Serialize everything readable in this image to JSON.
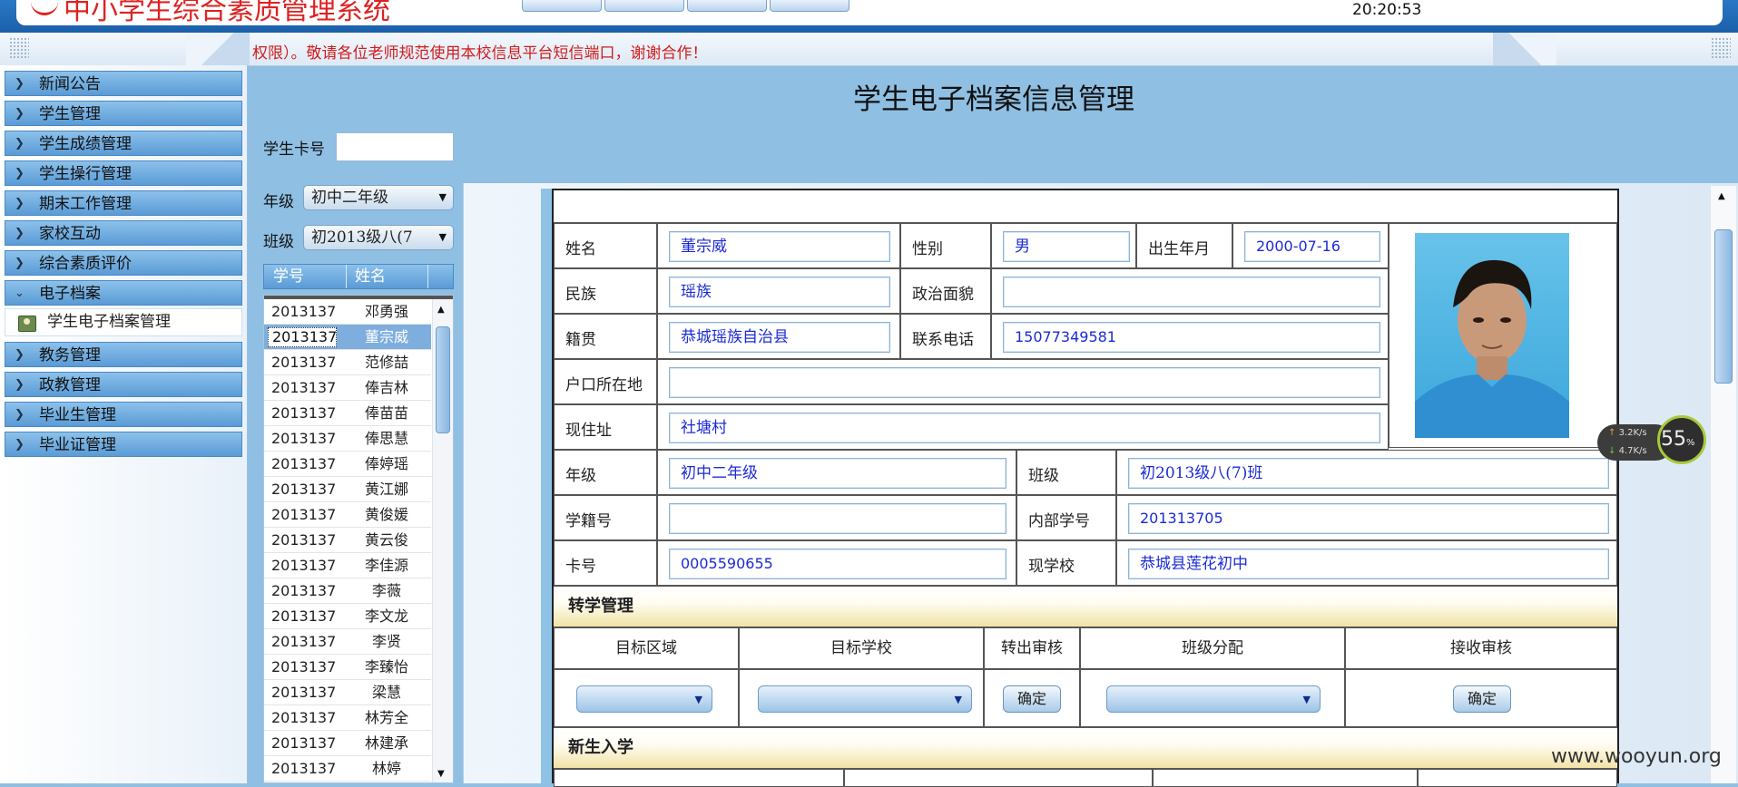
{
  "header": {
    "system_title": "中小学生综合素质管理系统",
    "clock": "20:20:53"
  },
  "marquee": "权限）。敬请各位老师规范使用本校信息平台短信端口，谢谢合作！",
  "sidebar": {
    "items": [
      {
        "label": "新闻公告"
      },
      {
        "label": "学生管理"
      },
      {
        "label": "学生成绩管理"
      },
      {
        "label": "学生操行管理"
      },
      {
        "label": "期末工作管理"
      },
      {
        "label": "家校互动"
      },
      {
        "label": "综合素质评价"
      },
      {
        "label": "电子档案"
      },
      {
        "label": "教务管理"
      },
      {
        "label": "政教管理"
      },
      {
        "label": "毕业生管理"
      },
      {
        "label": "毕业证管理"
      }
    ],
    "sub_item": "学生电子档案管理"
  },
  "main": {
    "title": "学生电子档案信息管理",
    "card_label": "学生卡号",
    "card_value": "",
    "grade_label": "年级",
    "grade_value": "初中二年级",
    "class_label": "班级",
    "class_value": "初2013级八(7",
    "list_headers": [
      "学号",
      "姓名"
    ],
    "students": [
      {
        "id": "2013137",
        "name": "邓勇强"
      },
      {
        "id": "2013137",
        "name": "董宗威"
      },
      {
        "id": "2013137",
        "name": "范修喆"
      },
      {
        "id": "2013137",
        "name": "俸吉林"
      },
      {
        "id": "2013137",
        "name": "俸苗苗"
      },
      {
        "id": "2013137",
        "name": "俸思慧"
      },
      {
        "id": "2013137",
        "name": "俸婷瑶"
      },
      {
        "id": "2013137",
        "name": "黄江娜"
      },
      {
        "id": "2013137",
        "name": "黄俊媛"
      },
      {
        "id": "2013137",
        "name": "黄云俊"
      },
      {
        "id": "2013137",
        "name": "李佳源"
      },
      {
        "id": "2013137",
        "name": "李薇"
      },
      {
        "id": "2013137",
        "name": "李文龙"
      },
      {
        "id": "2013137",
        "name": "李贤"
      },
      {
        "id": "2013137",
        "name": "李臻怡"
      },
      {
        "id": "2013137",
        "name": "梁慧"
      },
      {
        "id": "2013137",
        "name": "林芳全"
      },
      {
        "id": "2013137",
        "name": "林建承"
      },
      {
        "id": "2013137",
        "name": "林婷"
      }
    ]
  },
  "record": {
    "name_label": "姓名",
    "name": "董宗威",
    "gender_label": "性别",
    "gender": "男",
    "birth_label": "出生年月",
    "birth": "2000-07-16",
    "ethnic_label": "民族",
    "ethnic": "瑶族",
    "political_label": "政治面貌",
    "political": "",
    "native_label": "籍贯",
    "native": "恭城瑶族自治县",
    "phone_label": "联系电话",
    "phone": "15077349581",
    "hukou_label": "户口所在地",
    "hukou": "",
    "address_label": "现住址",
    "address": "社塘村",
    "grade_label": "年级",
    "grade": "初中二年级",
    "class_label": "班级",
    "class": "初2013级八(7)班",
    "xueji_label": "学籍号",
    "xueji": "",
    "inner_id_label": "内部学号",
    "inner_id": "201313705",
    "card_label": "卡号",
    "card": "0005590655",
    "school_label": "现学校",
    "school": "恭城县莲花初中"
  },
  "transfer": {
    "section_title": "转学管理",
    "headers": [
      "目标区域",
      "目标学校",
      "转出审核",
      "班级分配",
      "接收审核"
    ],
    "confirm_label": "确定"
  },
  "enroll": {
    "section_title": "新生入学"
  },
  "speed_widget": {
    "up": "3.2K/s",
    "down": "4.7K/s",
    "percent": "55",
    "unit": "%"
  },
  "watermark": "www.wooyun.org"
}
